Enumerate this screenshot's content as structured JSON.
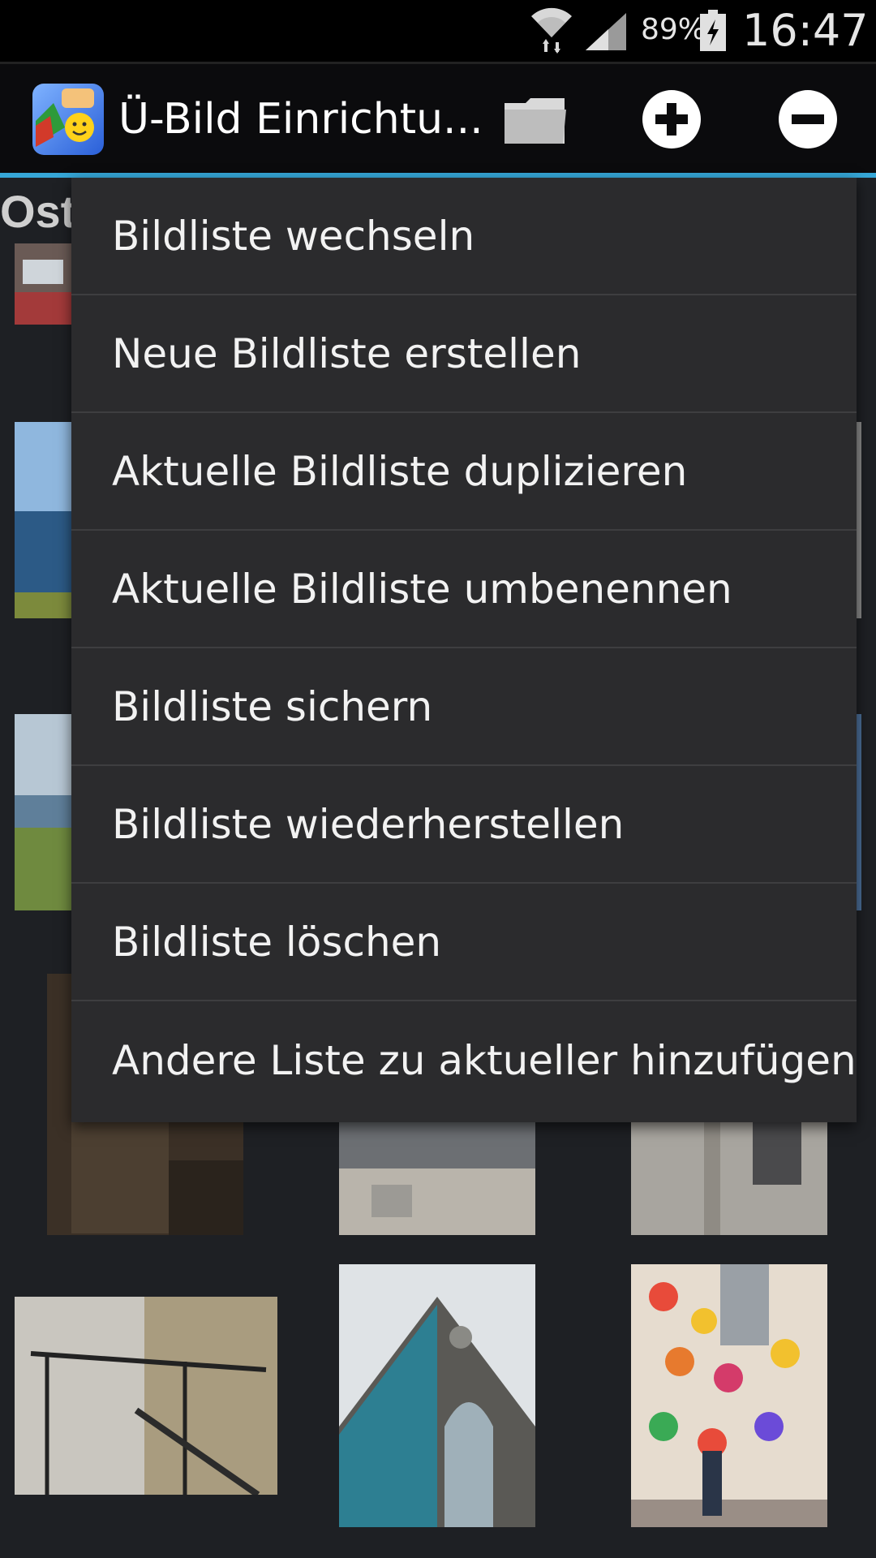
{
  "status_bar": {
    "battery_percent": "89%",
    "time": "16:47",
    "icons": [
      "wifi-icon",
      "signal-icon",
      "battery-charging-icon"
    ]
  },
  "action_bar": {
    "title": "Ü-Bild Einrichtu...",
    "icons": [
      "app-icon",
      "folder-icon",
      "plus-circle-icon",
      "minus-circle-icon"
    ]
  },
  "list": {
    "heading": "Ost"
  },
  "menu": {
    "items": [
      "Bildliste wechseln",
      "Neue Bildliste erstellen",
      "Aktuelle Bildliste duplizieren",
      "Aktuelle Bildliste umbenennen",
      "Bildliste sichern",
      "Bildliste wiederherstellen",
      "Bildliste löschen",
      "Andere Liste zu aktueller hinzufügen"
    ]
  },
  "colors": {
    "accent": "#36a7d7",
    "menu_background": "#2b2b2d",
    "page_background": "#1e2024"
  }
}
